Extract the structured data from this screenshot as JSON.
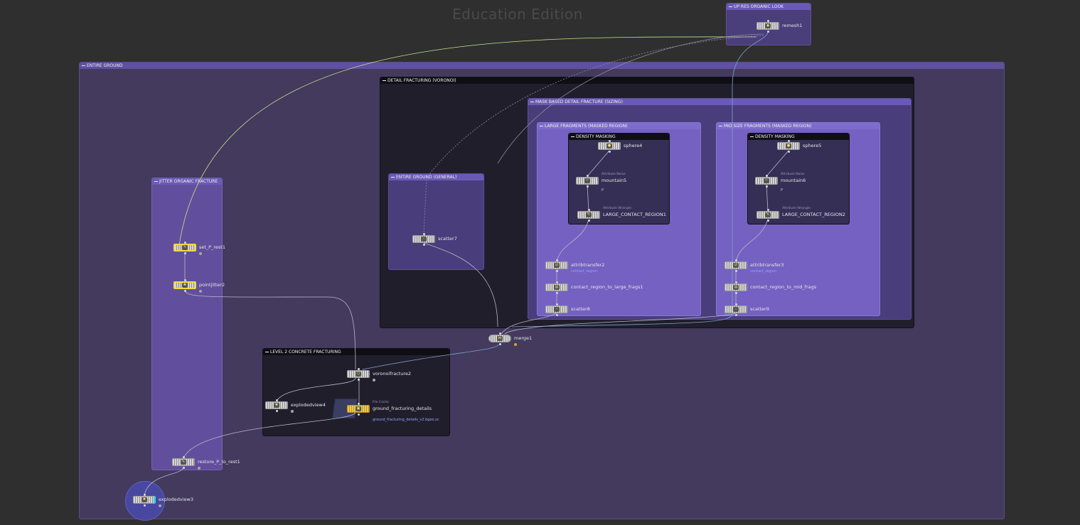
{
  "watermark": "Education Edition",
  "boxes": {
    "up_res": "UP RES ORGANIC LOOK",
    "entire_ground": "ENTIRE GROUND",
    "detail_fracturing": "DETAIL FRACTURING (VORONOI)",
    "mask_based": "MASK BASED DETAIL FRACTURE (SIZING)",
    "large_fragments": "LARGE FRAGMENTS (MASKED REGION)",
    "mid_size": "MID SIZE  FRAGMENTS (MASKED REGION)",
    "density_masking_1": "DENSITY MASKING",
    "density_masking_2": "DENSITY MASKING",
    "entire_ground_general": "ENTIRE GROUND (GENERAL)",
    "jitter": "JITTER ORGANIC FRACTURE",
    "level2": "LEVEL 2 CONCRETE FRACTURING"
  },
  "nodes": {
    "remesh1": {
      "label": "remesh1"
    },
    "sphere4": {
      "label": "sphere4"
    },
    "mountain5": {
      "label": "mountain5",
      "sub": "Attribute Noise",
      "info": "P"
    },
    "large_contact": {
      "label": "LARGE_CONTACT_REGION1",
      "sub": "Attribute Wrangle"
    },
    "sphere5": {
      "label": "sphere5"
    },
    "mountain6": {
      "label": "mountain6",
      "sub": "Attribute Noise",
      "info": "P"
    },
    "large_contact2": {
      "label": "LARGE_CONTACT_REGION2",
      "sub": "Attribute Wrangle"
    },
    "attribtransfer2": {
      "label": "attribtransfer2",
      "info": "contact_region"
    },
    "contact_large": {
      "label": "contact_region_to_large_frags1"
    },
    "scatter8": {
      "label": "scatter8"
    },
    "attribtransfer3": {
      "label": "attribtransfer3",
      "info": "contact_region"
    },
    "contact_mid": {
      "label": "contact_region_to_mid_frags"
    },
    "scatter9": {
      "label": "scatter9"
    },
    "scatter7": {
      "label": "scatter7"
    },
    "set_p_rest1": {
      "label": "set_P_rest1"
    },
    "pointjitter2": {
      "label": "pointjitter2"
    },
    "merge1": {
      "label": "merge1"
    },
    "voronoifracture2": {
      "label": "voronoifracture2"
    },
    "explodedview4": {
      "label": "explodedview4"
    },
    "ground_details": {
      "label": "ground_fracturing_details",
      "sub": "File Cache",
      "info": "ground_fracturing_details_v2.bgeo.sc"
    },
    "restore_p": {
      "label": "restore_P_to_rest1"
    },
    "explodedview3": {
      "label": "explodedview3"
    }
  },
  "colors": {
    "background": "#2f2f2f",
    "network_box_purple": "#6654a8",
    "selected_border": "#f5d93b",
    "file_cache_node": "#e6b93c",
    "wire": "#b8b8c8",
    "display_wire": "#c8e08a"
  }
}
